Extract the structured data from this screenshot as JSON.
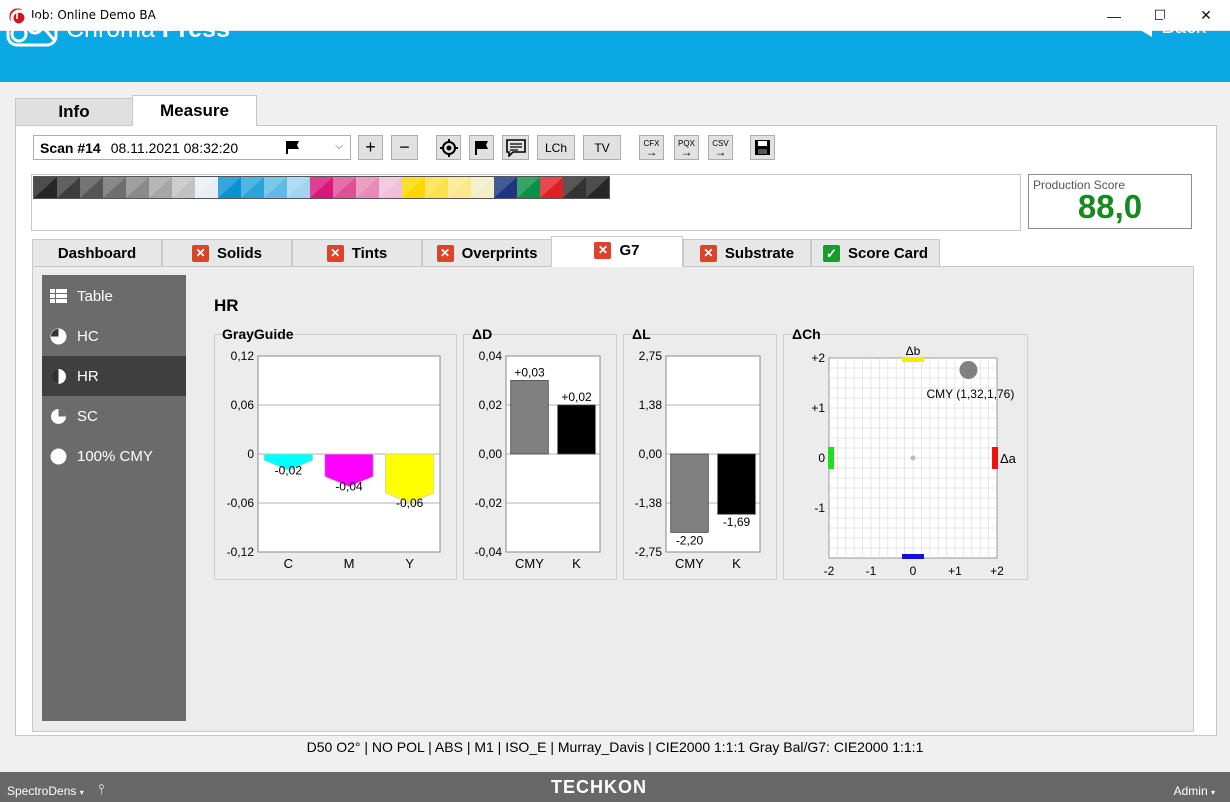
{
  "window": {
    "title": "Job: Online Demo BA",
    "app_icon_letter": "T",
    "minimize": "—",
    "maximize": "☐",
    "close": "✕"
  },
  "header": {
    "brand_light": "Chroma ",
    "brand_bold": "Press",
    "back_label": "Back",
    "bg_color": "#0ba8e6"
  },
  "main_tabs": [
    {
      "label": "Info",
      "active": false
    },
    {
      "label": "Measure",
      "active": true
    }
  ],
  "toolbar": {
    "scan_label": "Scan #14",
    "scan_date": "08.11.2021 08:32:20",
    "plus": "+",
    "minus": "−",
    "lch": "LCh",
    "tv": "TV",
    "export_cfx": "CFX",
    "export_pqx": "PQX",
    "export_csv": "CSV"
  },
  "color_strip": [
    "#262626",
    "#3d3d3d",
    "#555555",
    "#6f6f6f",
    "#8a8a8a",
    "#a6a6a6",
    "#c2c2c2",
    "#e8eef4",
    "#0a93d2",
    "#2aa5dc",
    "#5ebbe5",
    "#a0d4ef",
    "#d8177b",
    "#e05096",
    "#e78ab7",
    "#efc0d9",
    "#fbd800",
    "#fbe14a",
    "#fae88a",
    "#f2eec8",
    "#1c3680",
    "#0a9148",
    "#df2126",
    "#333333",
    "#262626"
  ],
  "score": {
    "label": "Production Score",
    "value": "88,0",
    "color": "#178a1f"
  },
  "sub_tabs": [
    {
      "label": "Dashboard",
      "status": "none"
    },
    {
      "label": "Solids",
      "status": "fail"
    },
    {
      "label": "Tints",
      "status": "fail"
    },
    {
      "label": "Overprints",
      "status": "fail"
    },
    {
      "label": "G7",
      "status": "fail",
      "active": true
    },
    {
      "label": "Substrate",
      "status": "fail"
    },
    {
      "label": "Score Card",
      "status": "pass"
    }
  ],
  "sidebar": [
    {
      "label": "Table",
      "icon": "table-icon"
    },
    {
      "label": "HC",
      "icon": "pie-quarter-icon"
    },
    {
      "label": "HR",
      "icon": "pie-half-icon",
      "active": true
    },
    {
      "label": "SC",
      "icon": "pie-three-quarter-icon"
    },
    {
      "label": "100% CMY",
      "icon": "circle-full-icon"
    }
  ],
  "section_title": "HR",
  "chart_data": [
    {
      "type": "bar",
      "title": "GrayGuide",
      "categories": [
        "C",
        "M",
        "Y"
      ],
      "values": [
        -0.02,
        -0.04,
        -0.06
      ],
      "value_labels": [
        "-0,02",
        "-0,04",
        "-0,06"
      ],
      "colors": [
        "#00ffff",
        "#ff00ff",
        "#ffff00"
      ],
      "yticks": [
        "0,12",
        "0,06",
        "0",
        "-0,06",
        "-0,12"
      ],
      "ylim": [
        -0.12,
        0.12
      ]
    },
    {
      "type": "bar",
      "title": "ΔD",
      "categories": [
        "CMY",
        "K"
      ],
      "values": [
        0.03,
        0.02
      ],
      "value_labels": [
        "+0,03",
        "+0,02"
      ],
      "colors": [
        "#808080",
        "#000000"
      ],
      "yticks": [
        "0,04",
        "0,02",
        "0,00",
        "-0,02",
        "-0,04"
      ],
      "ylim": [
        -0.04,
        0.04
      ]
    },
    {
      "type": "bar",
      "title": "ΔL",
      "categories": [
        "CMY",
        "K"
      ],
      "values": [
        -2.2,
        -1.69
      ],
      "value_labels": [
        "-2,20",
        "-1,69"
      ],
      "colors": [
        "#808080",
        "#000000"
      ],
      "yticks": [
        "2,75",
        "1,38",
        "0,00",
        "-1,38",
        "-2,75"
      ],
      "ylim": [
        -2.75,
        2.75
      ]
    },
    {
      "type": "scatter",
      "title": "ΔCh",
      "xticks": [
        "-2",
        "-1",
        "0",
        "+1",
        "+2"
      ],
      "yticks": [
        "+2",
        "+1",
        "0",
        "-1"
      ],
      "xlim": [
        -2,
        2
      ],
      "ylim": [
        -2,
        2
      ],
      "axis_a_label": "Δa",
      "axis_b_label": "Δb",
      "points": [
        {
          "label": "CMY (1,32,1,76)",
          "x": 1.32,
          "y": 1.76,
          "color": "#808080"
        }
      ]
    }
  ],
  "status_line": "D50 O2° | NO POL | ABS | M1 | ISO_E | Murray_Davis | CIE2000 1:1:1   Gray Bal/G7: CIE2000 1:1:1",
  "bottom_bar": {
    "left": "SpectroDens",
    "brand": "TECHKON",
    "right": "Admin"
  }
}
